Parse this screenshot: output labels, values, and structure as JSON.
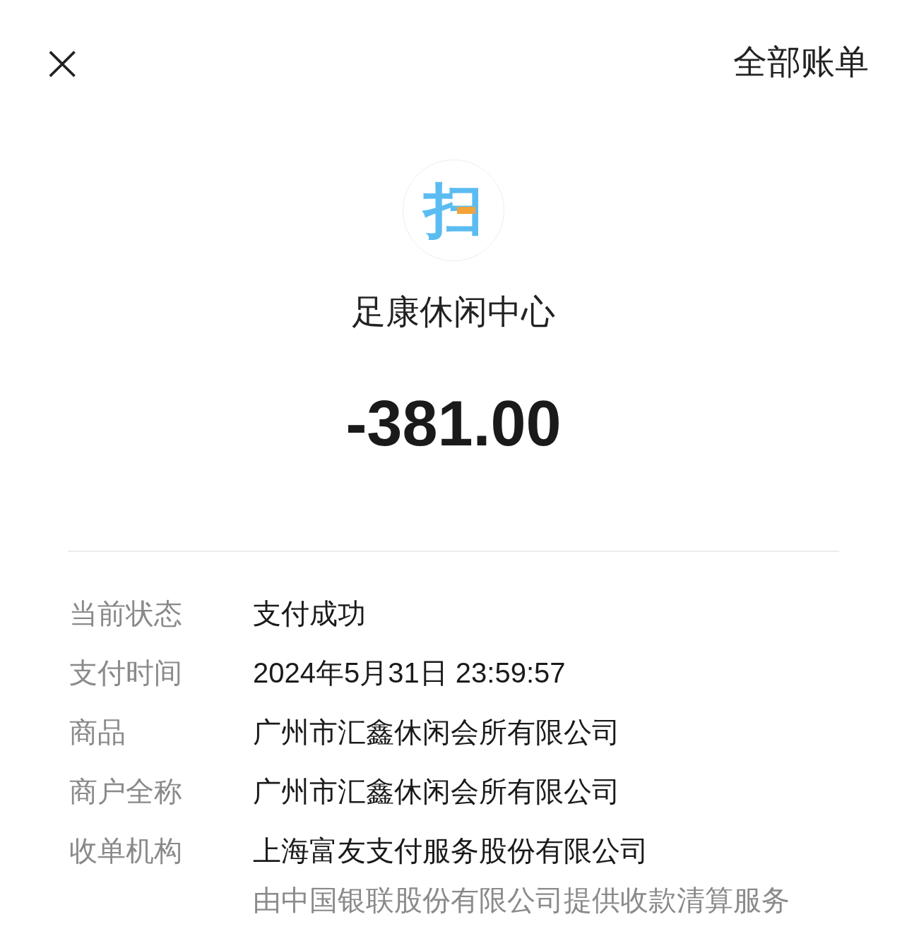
{
  "header": {
    "close": "×",
    "title": "全部账单"
  },
  "merchant": {
    "logo_char": "扫",
    "name": "足康休闲中心",
    "amount": "-381.00"
  },
  "details": [
    {
      "label": "当前状态",
      "value": "支付成功"
    },
    {
      "label": "支付时间",
      "value": "2024年5月31日 23:59:57"
    },
    {
      "label": "商品",
      "value": "广州市汇鑫休闲会所有限公司"
    },
    {
      "label": "商户全称",
      "value": "广州市汇鑫休闲会所有限公司"
    },
    {
      "label": "收单机构",
      "value": "上海富友支付服务股份有限公司",
      "note": "由中国银联股份有限公司提供收款清算服务"
    }
  ]
}
